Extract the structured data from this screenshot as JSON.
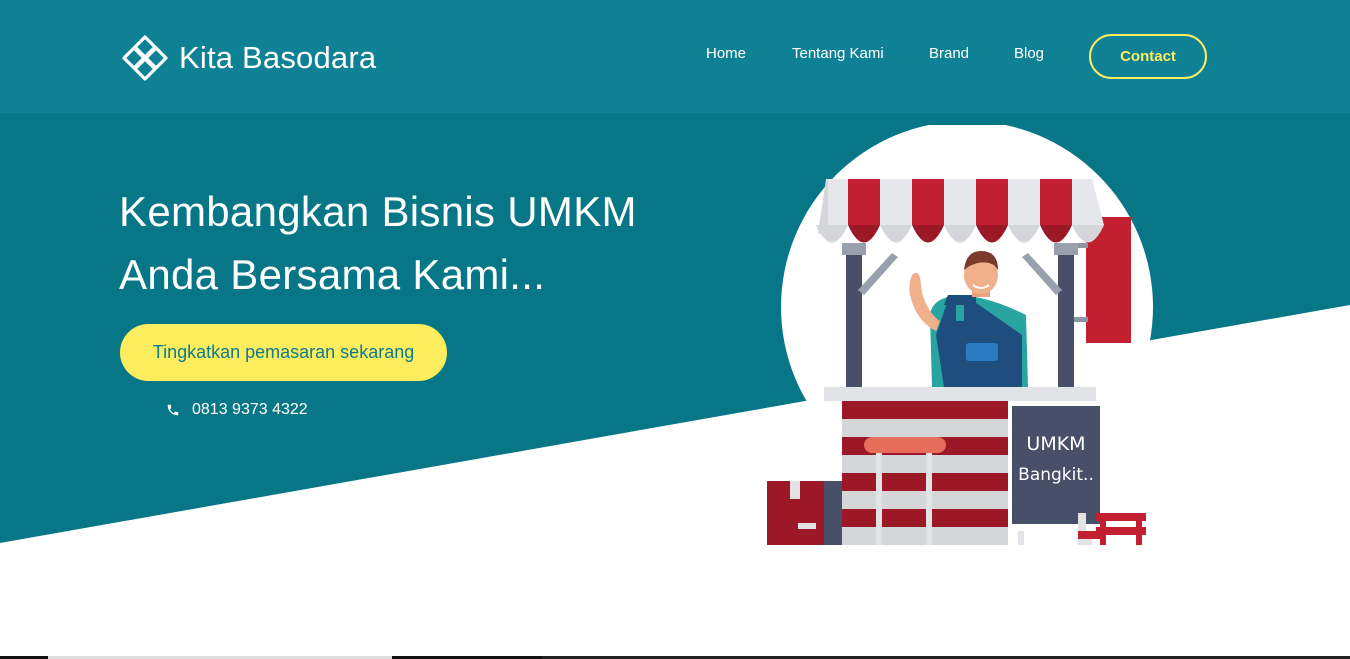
{
  "header": {
    "brand_name": "Kita Basodara",
    "logo_icon": "flower-logo-icon",
    "nav": [
      {
        "label": "Home"
      },
      {
        "label": "Tentang Kami"
      },
      {
        "label": "Brand"
      },
      {
        "label": "Blog"
      }
    ],
    "contact_label": "Contact"
  },
  "hero": {
    "title_line1": "Kembangkan Bisnis UMKM",
    "title_line2": "Anda Bersama Kami...",
    "cta_label": "Tingkatkan pemasaran sekarang",
    "phone_icon": "phone-icon",
    "phone": "0813 9373 4322"
  },
  "illustration": {
    "sign_line1": "UMKM",
    "sign_line2": "Bangkit.."
  },
  "colors": {
    "header_bg": "#0f8195",
    "hero_bg": "#077788",
    "accent_yellow": "#fced5f",
    "awning_red": "#c21f30",
    "sign_bg": "#474f69"
  }
}
